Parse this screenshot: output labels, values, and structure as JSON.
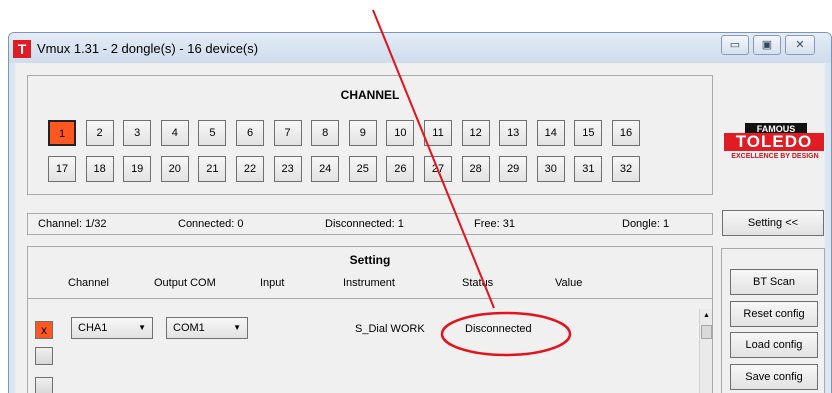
{
  "window": {
    "app_icon_letter": "T",
    "title": "Vmux 1.31 - 2 dongle(s) - 16 device(s)",
    "controls": {
      "minimize": "▭",
      "maximize": "▣",
      "close": "✕"
    }
  },
  "channel_panel": {
    "title": "CHANNEL",
    "buttons": [
      "1",
      "2",
      "3",
      "4",
      "5",
      "6",
      "7",
      "8",
      "9",
      "10",
      "11",
      "12",
      "13",
      "14",
      "15",
      "16",
      "17",
      "18",
      "19",
      "20",
      "21",
      "22",
      "23",
      "24",
      "25",
      "26",
      "27",
      "28",
      "29",
      "30",
      "31",
      "32"
    ],
    "active_channel": "1",
    "active_color": "#ff5722"
  },
  "logo": {
    "top": "FAMOUS",
    "brand": "TOLEDO",
    "tagline": "EXCELLENCE BY DESIGN"
  },
  "status": {
    "channel": "Channel: 1/32",
    "connected": "Connected: 0",
    "disconnected": "Disconnected: 1",
    "free": "Free: 31",
    "dongle": "Dongle: 1"
  },
  "setting_toggle_label": "Setting <<",
  "setting": {
    "title": "Setting",
    "columns": [
      "Channel",
      "Output COM",
      "Input",
      "Instrument",
      "Status",
      "Value"
    ],
    "rows": [
      {
        "checked": true,
        "check_mark": "x",
        "channel": "CHA1",
        "output_com": "COM1",
        "instrument": "S_Dial WORK",
        "status": "Disconnected"
      }
    ]
  },
  "side_buttons": [
    "BT Scan",
    "Reset config",
    "Load config",
    "Save config"
  ],
  "annotation_color": "#e4131b"
}
